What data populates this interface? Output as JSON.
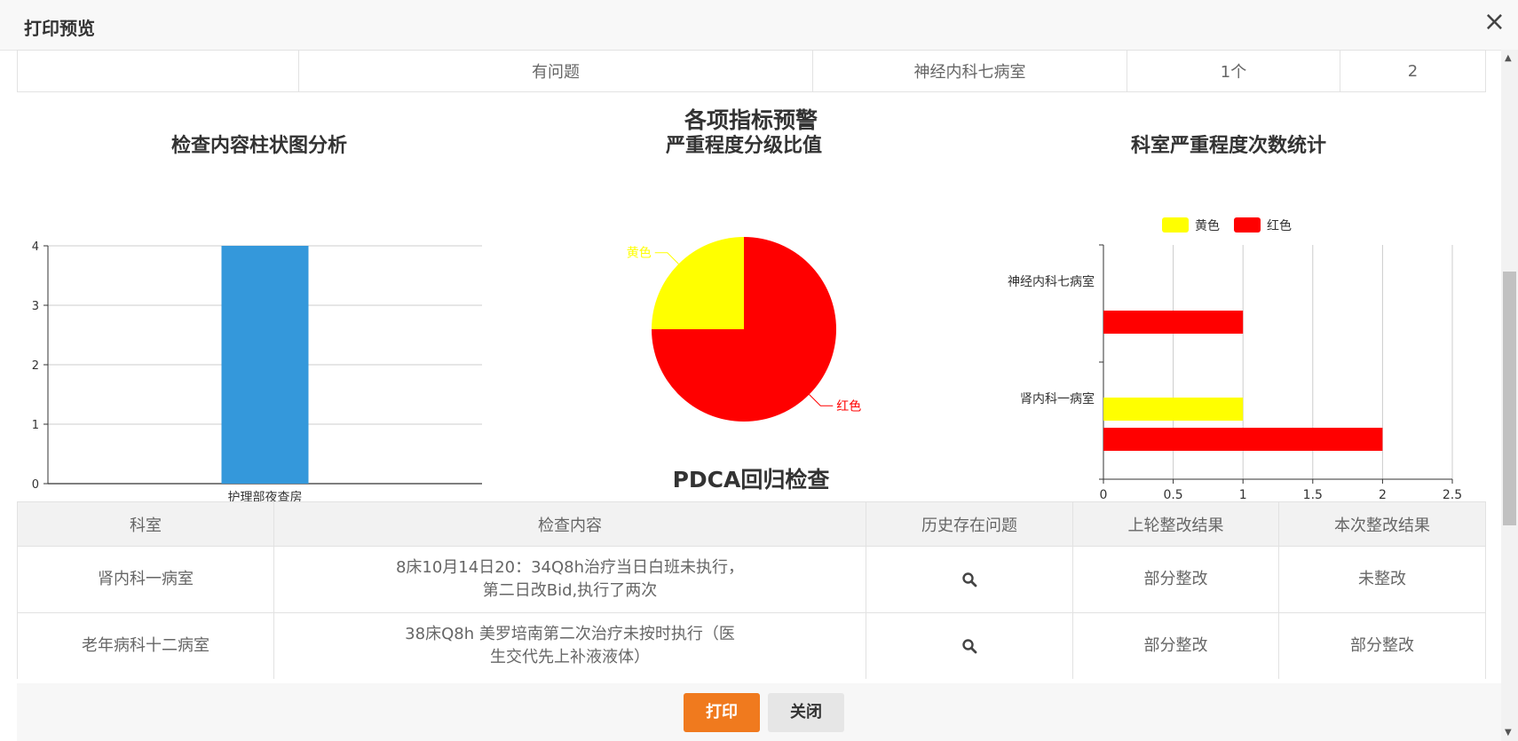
{
  "dialog": {
    "title": "打印预览",
    "close_glyph": "×"
  },
  "top_row": [
    "",
    "有问题",
    "神经内科七病室",
    "1个",
    "2"
  ],
  "charts": {
    "bar_title": "检查内容柱状图分析",
    "pie_title_1": "各项指标预警",
    "pie_title_2": "严重程度分级比值",
    "hbar_title": "科室严重程度次数统计"
  },
  "chart_data": [
    {
      "type": "bar",
      "title": "检查内容柱状图分析",
      "categories": [
        "护理部夜查房"
      ],
      "values": [
        4
      ],
      "ylim": [
        0,
        4
      ],
      "yticks": [
        0,
        1,
        2,
        3,
        4
      ],
      "color": "#3498db"
    },
    {
      "type": "pie",
      "title": "严重程度分级比值",
      "labels": [
        "黄色",
        "红色"
      ],
      "values": [
        1,
        3
      ],
      "colors": [
        "#ffff00",
        "#ff0000"
      ]
    },
    {
      "type": "bar",
      "orientation": "horizontal",
      "title": "科室严重程度次数统计",
      "categories": [
        "肾内科一病室",
        "神经内科七病室"
      ],
      "series": [
        {
          "name": "黄色",
          "values": [
            1,
            0
          ],
          "color": "#ffff00"
        },
        {
          "name": "红色",
          "values": [
            2,
            1
          ],
          "color": "#ff0000"
        }
      ],
      "xlim": [
        0,
        2.5
      ],
      "xticks": [
        "0",
        "0.5",
        "1",
        "1.5",
        "2",
        "2.5"
      ],
      "legend": "top"
    }
  ],
  "pdca": {
    "title": "PDCA回归检查",
    "headers": [
      "科室",
      "检查内容",
      "历史存在问题",
      "上轮整改结果",
      "本次整改结果"
    ],
    "rows": [
      {
        "dept": "肾内科一病室",
        "content_line1": "8床10月14日20：34Q8h治疗当日白班未执行，",
        "content_line2": "第二日改Bid,执行了两次",
        "history_icon": "search-icon",
        "last": "部分整改",
        "current": "未整改"
      },
      {
        "dept": "老年病科十二病室",
        "content_line1": "38床Q8h 美罗培南第二次治疗未按时执行（医",
        "content_line2": "生交代先上补液液体）",
        "history_icon": "search-icon",
        "last": "部分整改",
        "current": "部分整改"
      }
    ]
  },
  "buttons": {
    "print": "打印",
    "close": "关闭"
  }
}
